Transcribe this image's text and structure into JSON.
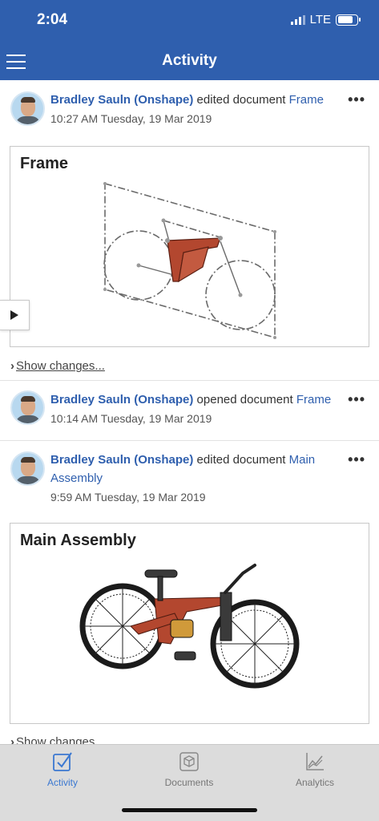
{
  "status": {
    "time": "2:04",
    "network": "LTE"
  },
  "header": {
    "title": "Activity"
  },
  "feed": [
    {
      "user": "Bradley Sauln (Onshape)",
      "action": "edited document",
      "document": "Frame",
      "timestamp": "10:27 AM Tuesday, 19 Mar 2019",
      "card_title": "Frame",
      "show_changes": "Show changes..."
    },
    {
      "user": "Bradley Sauln (Onshape)",
      "action": "opened document",
      "document": "Frame",
      "timestamp": "10:14 AM Tuesday, 19 Mar 2019"
    },
    {
      "user": "Bradley Sauln (Onshape)",
      "action": "edited document",
      "document": "Main Assembly",
      "timestamp": "9:59 AM Tuesday, 19 Mar 2019",
      "card_title": "Main Assembly",
      "show_changes": "Show changes..."
    }
  ],
  "more_label": "•••",
  "tabs": [
    {
      "label": "Activity",
      "icon": "activity-check-icon",
      "active": true
    },
    {
      "label": "Documents",
      "icon": "documents-cube-icon",
      "active": false
    },
    {
      "label": "Analytics",
      "icon": "analytics-chart-icon",
      "active": false
    }
  ],
  "colors": {
    "brand": "#2f5fae",
    "link": "#2f5fae",
    "active_tab": "#3b78d1",
    "frame_part": "#b3472f"
  }
}
